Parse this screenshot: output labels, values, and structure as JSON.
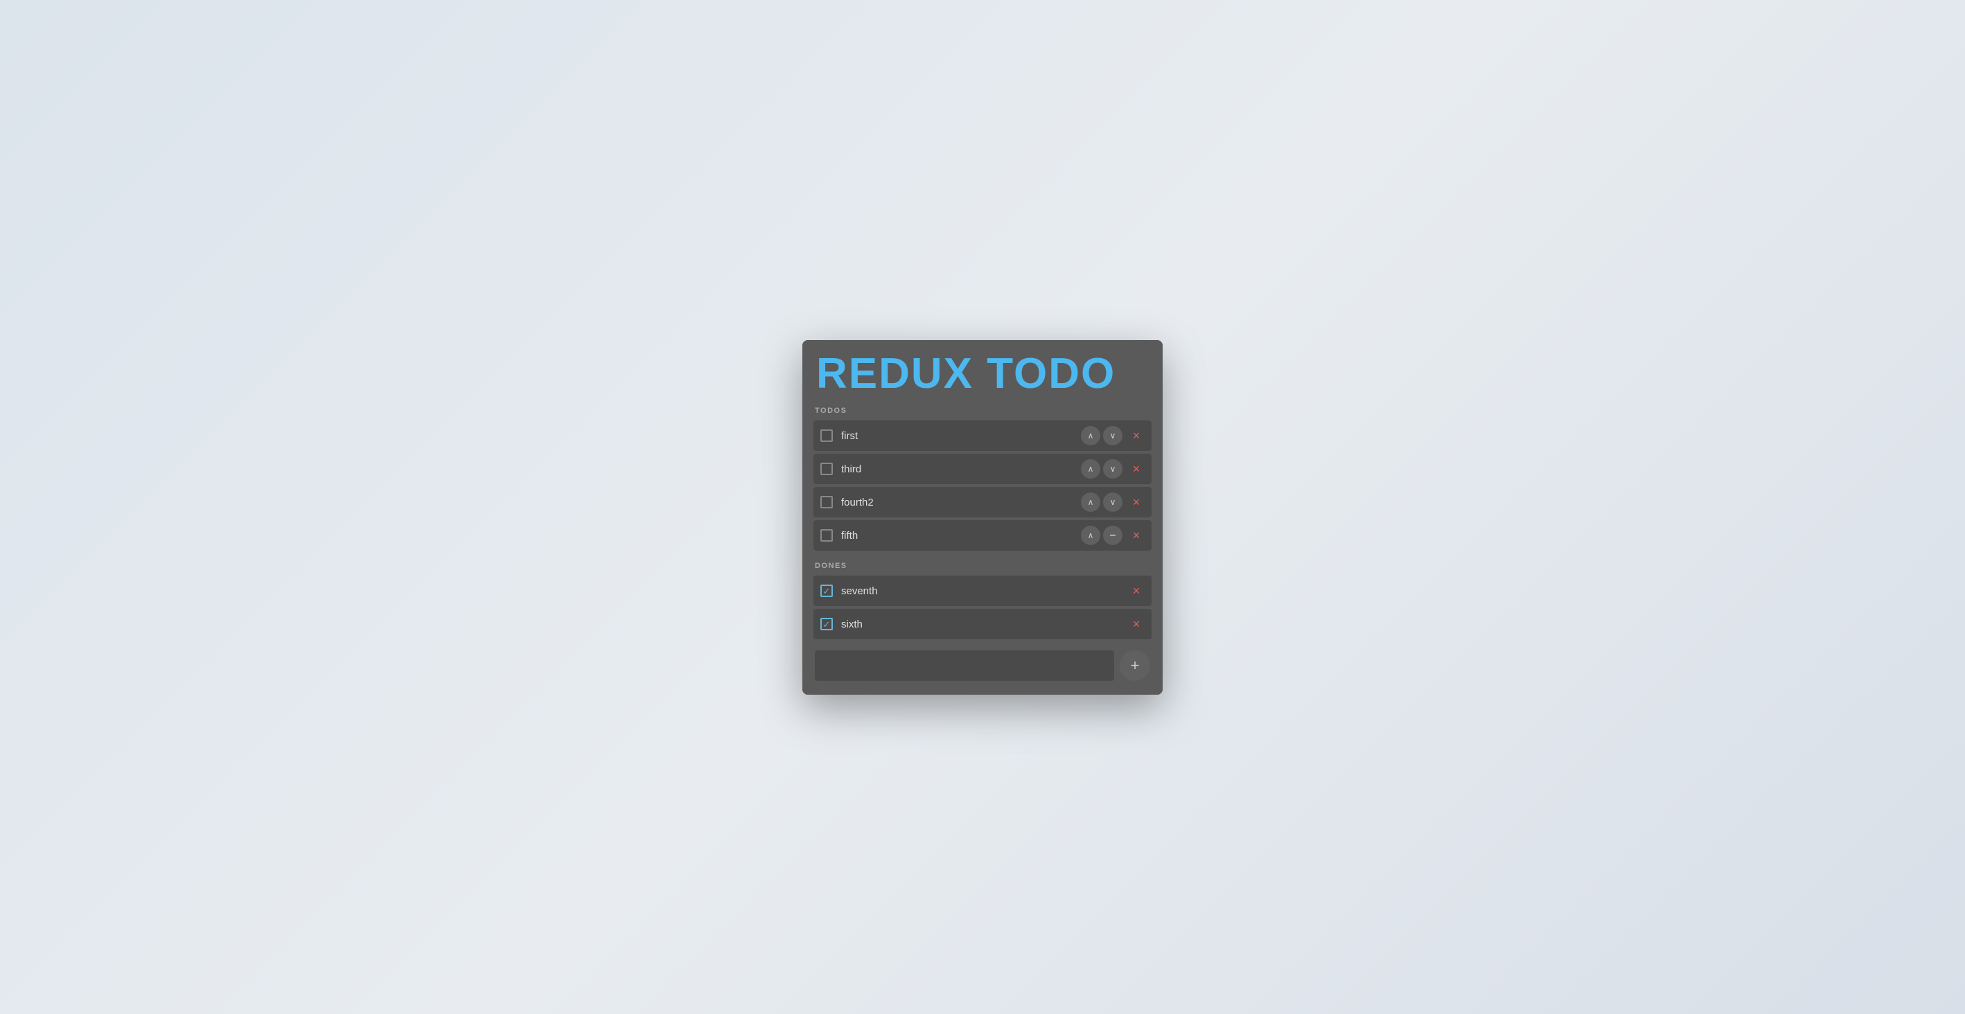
{
  "app": {
    "title": "REDUX TODO"
  },
  "sections": {
    "todos_label": "TODOS",
    "dones_label": "DONES"
  },
  "todos": [
    {
      "id": 1,
      "text": "first",
      "checked": false,
      "has_up": false,
      "has_down": true
    },
    {
      "id": 2,
      "text": "third",
      "checked": false,
      "has_up": true,
      "has_down": true
    },
    {
      "id": 3,
      "text": "fourth2",
      "checked": false,
      "has_up": true,
      "has_down": true
    },
    {
      "id": 4,
      "text": "fifth",
      "checked": false,
      "has_up": true,
      "has_down": false
    }
  ],
  "dones": [
    {
      "id": 5,
      "text": "seventh",
      "checked": true
    },
    {
      "id": 6,
      "text": "sixth",
      "checked": true
    }
  ],
  "add_input": {
    "placeholder": "",
    "value": ""
  },
  "buttons": {
    "add_label": "+",
    "delete_label": "×",
    "up_label": "∧",
    "down_label": "∨",
    "dash_label": "–"
  }
}
